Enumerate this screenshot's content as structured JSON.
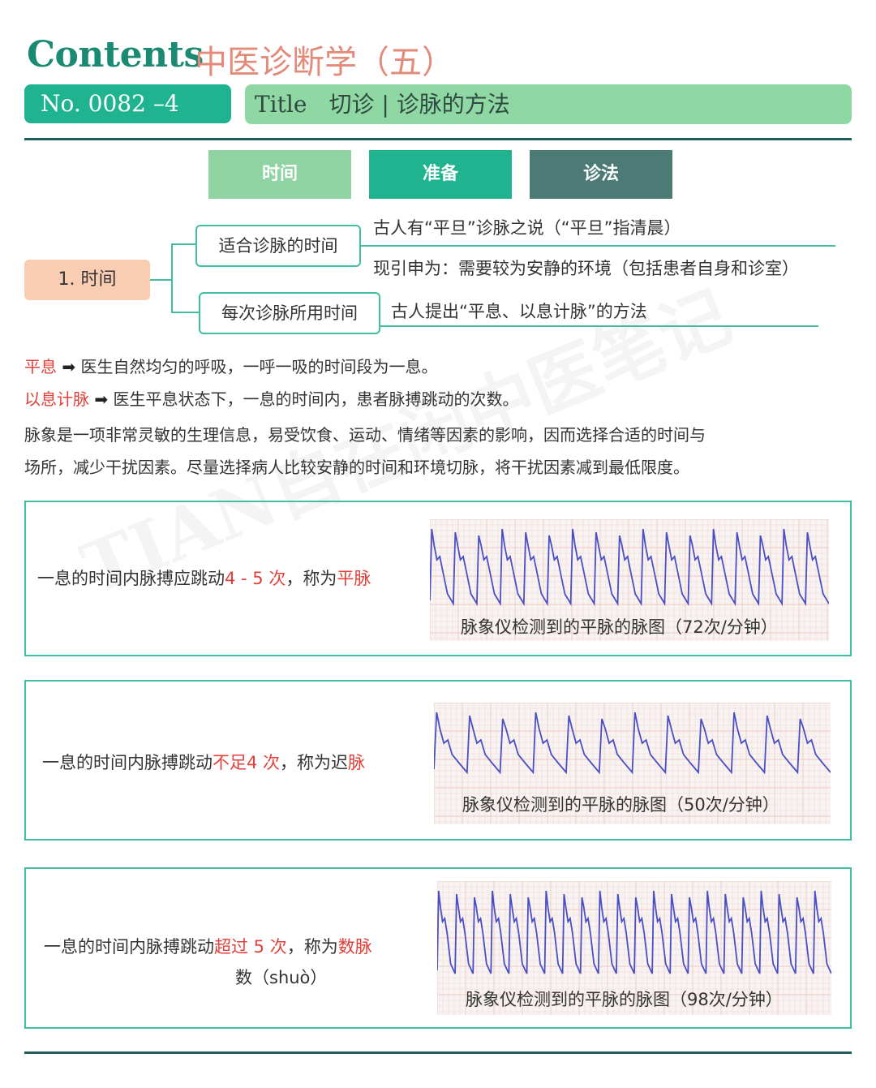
{
  "header": {
    "contents_word": "Contents",
    "series_title": "中医诊断学（五）",
    "number_label": "No.  0082 –4",
    "title_word": "Title",
    "title_text": "切诊 | 诊脉的方法"
  },
  "tabs": [
    {
      "label": "时间",
      "color": "#8fd3a3"
    },
    {
      "label": "准备",
      "color": "#1fb390"
    },
    {
      "label": "诊法",
      "color": "#4c7a74"
    }
  ],
  "mindmap": {
    "root": "1.  时间",
    "branches": [
      {
        "label": "适合诊脉的时间",
        "lines": [
          "古人有“平旦”诊脉之说（“平旦”指清晨）",
          "现引申为：需要较为安静的环境（包括患者自身和诊室）"
        ]
      },
      {
        "label": "每次诊脉所用时间",
        "lines": [
          "古人提出“平息、以息计脉”的方法"
        ]
      }
    ]
  },
  "definitions": [
    {
      "term": "平息",
      "text": "医生自然均匀的呼吸，一呼一吸的时间段为一息。"
    },
    {
      "term": "以息计脉",
      "text": "医生平息状态下，一息的时间内，患者脉搏跳动的次数。"
    }
  ],
  "paragraph": [
    "脉象是一项非常灵敏的生理信息，易受饮食、运动、情绪等因素的影响，因而选择合适的时间与",
    "场所，减少干扰因素。尽量选择病人比较安静的时间和环境切脉，将干扰因素减到最低限度。"
  ],
  "panels": [
    {
      "pre": "一息的时间内脉搏应跳动",
      "count": "4 - 5 次",
      "mid": "，称为",
      "name": "平脉",
      "name2": "",
      "caption": "脉象仪检测到的平脉的脉图（72次/分钟）",
      "beats": 17
    },
    {
      "pre": "一息的时间内脉搏跳动",
      "count": "不足4 次",
      "mid": "，称为迟",
      "name": "脉",
      "name2": "",
      "caption": "脉象仪检测到的平脉的脉图（50次/分钟）",
      "beats": 12
    },
    {
      "pre": "一息的时间内脉搏跳动",
      "count": "超过 5 次",
      "mid": "，称为",
      "name": "数脉",
      "name2": "数（shuò）",
      "caption": "脉象仪检测到的平脉的脉图（98次/分钟）",
      "beats": 22
    }
  ],
  "watermark": "TIAN自在闲中医笔记",
  "colors": {
    "accent": "#1fb390",
    "red": "#e0413a",
    "ecg_line": "#4a4fc4",
    "grid": "#f0c9c2"
  }
}
